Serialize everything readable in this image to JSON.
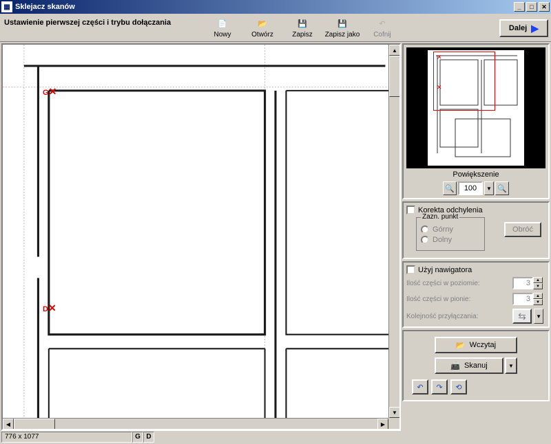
{
  "window": {
    "title": "Sklejacz skanów"
  },
  "instruction": "Ustawienie pierwszej części  i trybu dołączania",
  "toolbar": {
    "new": "Nowy",
    "open": "Otwórz",
    "save": "Zapisz",
    "saveas": "Zapisz jako",
    "undo": "Cofnij"
  },
  "next": "Dalej",
  "status": {
    "dimensions": "776 x 1077",
    "g": "G",
    "d": "D"
  },
  "markers": {
    "g": "G",
    "d": "D"
  },
  "zoom": {
    "label": "Powiększenie",
    "value": "100"
  },
  "korekta": {
    "checkbox": "Korekta odchylenia",
    "group": "Zazn. punkt",
    "top": "Górny",
    "bottom": "Dolny",
    "rotate": "Obróć"
  },
  "navigator": {
    "checkbox": "Użyj nawigatora",
    "horiz": "Ilość części w poziomie:",
    "vert": "Ilość części w pionie:",
    "order": "Kolejność przyłączania:",
    "horiz_val": "3",
    "vert_val": "3"
  },
  "actions": {
    "load": "Wczytaj",
    "scan": "Skanuj"
  }
}
